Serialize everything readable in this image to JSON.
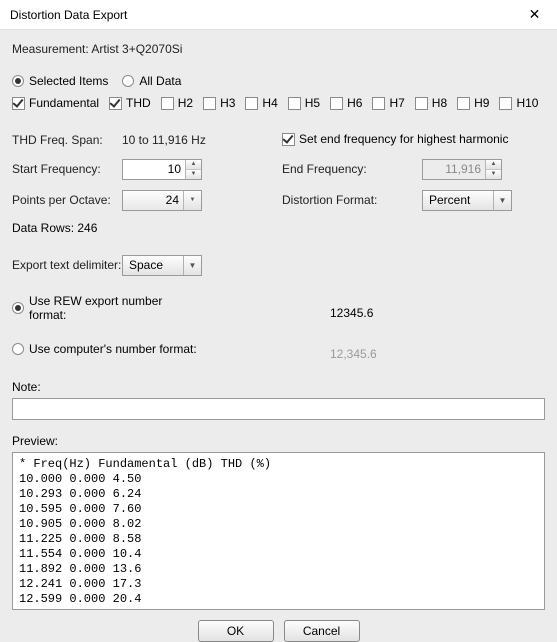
{
  "window": {
    "title": "Distortion Data Export"
  },
  "measurement_label": "Measurement:",
  "measurement_value": "Artist 3+Q2070Si",
  "scope": {
    "selected_items": "Selected Items",
    "all_data": "All Data",
    "choice": "selected"
  },
  "harmonics": {
    "fundamental": "Fundamental",
    "thd": "THD",
    "h2": "H2",
    "h3": "H3",
    "h4": "H4",
    "h5": "H5",
    "h6": "H6",
    "h7": "H7",
    "h8": "H8",
    "h9": "H9",
    "h10": "H10",
    "checked": {
      "fundamental": true,
      "thd": true
    }
  },
  "freq": {
    "span_label": "THD Freq. Span:",
    "span_value": "10 to 11,916 Hz",
    "set_end_label": "Set end frequency for highest harmonic",
    "set_end_checked": true,
    "start_label": "Start Frequency:",
    "start_value": "10",
    "end_label": "End Frequency:",
    "end_value": "11,916",
    "end_disabled": true,
    "ppo_label": "Points per Octave:",
    "ppo_value": "24",
    "fmt_label": "Distortion Format:",
    "fmt_value": "Percent"
  },
  "datarows": {
    "label": "Data Rows:",
    "value": "246"
  },
  "delimiter": {
    "label": "Export text delimiter:",
    "value": "Space"
  },
  "numfmt": {
    "rew_label": "Use REW export number format:",
    "rew_example": "12345.6",
    "cpu_label": "Use computer's number format:",
    "cpu_example": "12,345.6",
    "choice": "rew"
  },
  "note": {
    "label": "Note:",
    "value": ""
  },
  "preview": {
    "label": "Preview:",
    "header": "* Freq(Hz) Fundamental (dB) THD (%)",
    "rows": [
      "10.000 0.000 4.50",
      "10.293 0.000 6.24",
      "10.595 0.000 7.60",
      "10.905 0.000 8.02",
      "11.225 0.000 8.58",
      "11.554 0.000 10.4",
      "11.892 0.000 13.6",
      "12.241 0.000 17.3",
      "12.599 0.000 20.4"
    ]
  },
  "buttons": {
    "ok": "OK",
    "cancel": "Cancel"
  },
  "chart_data": {
    "type": "table",
    "title": "Distortion export preview",
    "columns": [
      "Freq(Hz)",
      "Fundamental (dB)",
      "THD (%)"
    ],
    "rows": [
      [
        10.0,
        0.0,
        4.5
      ],
      [
        10.293,
        0.0,
        6.24
      ],
      [
        10.595,
        0.0,
        7.6
      ],
      [
        10.905,
        0.0,
        8.02
      ],
      [
        11.225,
        0.0,
        8.58
      ],
      [
        11.554,
        0.0,
        10.4
      ],
      [
        11.892,
        0.0,
        13.6
      ],
      [
        12.241,
        0.0,
        17.3
      ],
      [
        12.599,
        0.0,
        20.4
      ]
    ]
  }
}
